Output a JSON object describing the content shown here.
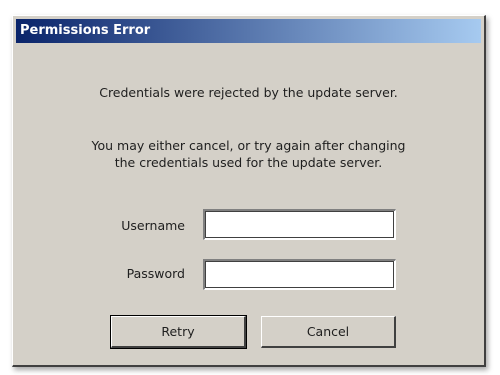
{
  "dialog": {
    "title": "Permissions Error",
    "message": "Credentials were rejected by the update server.",
    "instruction_line1": "You may either cancel, or try again after changing",
    "instruction_line2": "the credentials used for the update server.",
    "username_label": "Username",
    "username_value": "",
    "password_label": "Password",
    "password_value": "",
    "retry_label": "Retry",
    "cancel_label": "Cancel"
  },
  "colors": {
    "dialog_background": "#d4d0c8",
    "titlebar_start": "#0a246a",
    "titlebar_end": "#a6caf0",
    "titlebar_text": "#ffffff"
  }
}
